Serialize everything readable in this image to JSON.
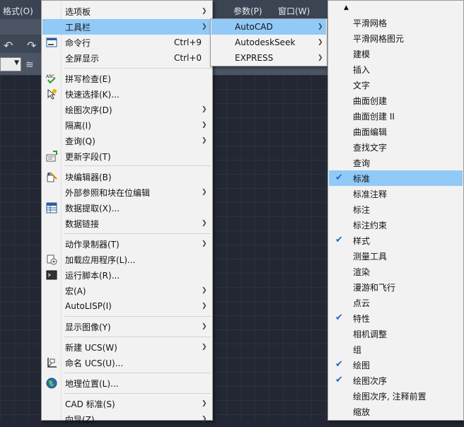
{
  "menubar": {
    "items": [
      {
        "label": "格式(O)"
      },
      {
        "label": "参数(P)"
      },
      {
        "label": "窗口(W)"
      }
    ]
  },
  "main_menu": {
    "items": [
      {
        "label": "选项板",
        "submenu": true
      },
      {
        "label": "工具栏",
        "submenu": true,
        "highlighted": true
      },
      {
        "label": "命令行",
        "shortcut": "Ctrl+9",
        "icon": "command-line-icon"
      },
      {
        "label": "全屏显示",
        "shortcut": "Ctrl+0"
      },
      {
        "label": "拼写检查(E)",
        "icon": "spell-check-icon"
      },
      {
        "label": "快速选择(K)...",
        "icon": "quick-select-icon"
      },
      {
        "label": "绘图次序(D)",
        "submenu": true
      },
      {
        "label": "隔离(I)",
        "submenu": true
      },
      {
        "label": "查询(Q)",
        "submenu": true
      },
      {
        "label": "更新字段(T)",
        "icon": "update-field-icon"
      },
      {
        "label": "块编辑器(B)",
        "icon": "block-editor-icon"
      },
      {
        "label": "外部参照和块在位编辑",
        "submenu": true
      },
      {
        "label": "数据提取(X)...",
        "icon": "data-extraction-icon"
      },
      {
        "label": "数据链接",
        "submenu": true
      },
      {
        "label": "动作录制器(T)",
        "submenu": true
      },
      {
        "label": "加载应用程序(L)...",
        "icon": "load-app-icon"
      },
      {
        "label": "运行脚本(R)...",
        "icon": "run-script-icon"
      },
      {
        "label": "宏(A)",
        "submenu": true
      },
      {
        "label": "AutoLISP(I)",
        "submenu": true
      },
      {
        "label": "显示图像(Y)",
        "submenu": true
      },
      {
        "label": "新建 UCS(W)",
        "submenu": true
      },
      {
        "label": "命名 UCS(U)...",
        "icon": "named-ucs-icon"
      },
      {
        "label": "地理位置(L)...",
        "icon": "geolocation-icon"
      },
      {
        "label": "CAD 标准(S)",
        "submenu": true
      },
      {
        "label": "向导(Z)",
        "submenu": true
      }
    ]
  },
  "toolbar_menu": {
    "items": [
      {
        "label": "AutoCAD",
        "highlighted": true
      },
      {
        "label": "AutodeskSeek"
      },
      {
        "label": "EXPRESS"
      }
    ]
  },
  "autocad_menu": {
    "items": [
      {
        "label": "平滑网格",
        "checked": false
      },
      {
        "label": "平滑网格图元",
        "checked": false
      },
      {
        "label": "建模",
        "checked": false
      },
      {
        "label": "插入",
        "checked": false
      },
      {
        "label": "文字",
        "checked": false
      },
      {
        "label": "曲面创建",
        "checked": false
      },
      {
        "label": "曲面创建 II",
        "checked": false
      },
      {
        "label": "曲面编辑",
        "checked": false
      },
      {
        "label": "查找文字",
        "checked": false
      },
      {
        "label": "查询",
        "checked": false
      },
      {
        "label": "标准",
        "checked": true,
        "highlighted": true
      },
      {
        "label": "标准注释",
        "checked": false
      },
      {
        "label": "标注",
        "checked": false
      },
      {
        "label": "标注约束",
        "checked": false
      },
      {
        "label": "样式",
        "checked": true
      },
      {
        "label": "测量工具",
        "checked": false
      },
      {
        "label": "渲染",
        "checked": false
      },
      {
        "label": "漫游和飞行",
        "checked": false
      },
      {
        "label": "点云",
        "checked": false
      },
      {
        "label": "特性",
        "checked": true
      },
      {
        "label": "相机调整",
        "checked": false
      },
      {
        "label": "组",
        "checked": false
      },
      {
        "label": "绘图",
        "checked": true
      },
      {
        "label": "绘图次序",
        "checked": true
      },
      {
        "label": "绘图次序, 注释前置",
        "checked": false
      },
      {
        "label": "缩放",
        "checked": false
      }
    ]
  },
  "colors": {
    "highlight": "#91c9f7",
    "menu_bg": "#f2f2f2",
    "check": "#1a6fbf",
    "app_bg": "#222733"
  }
}
